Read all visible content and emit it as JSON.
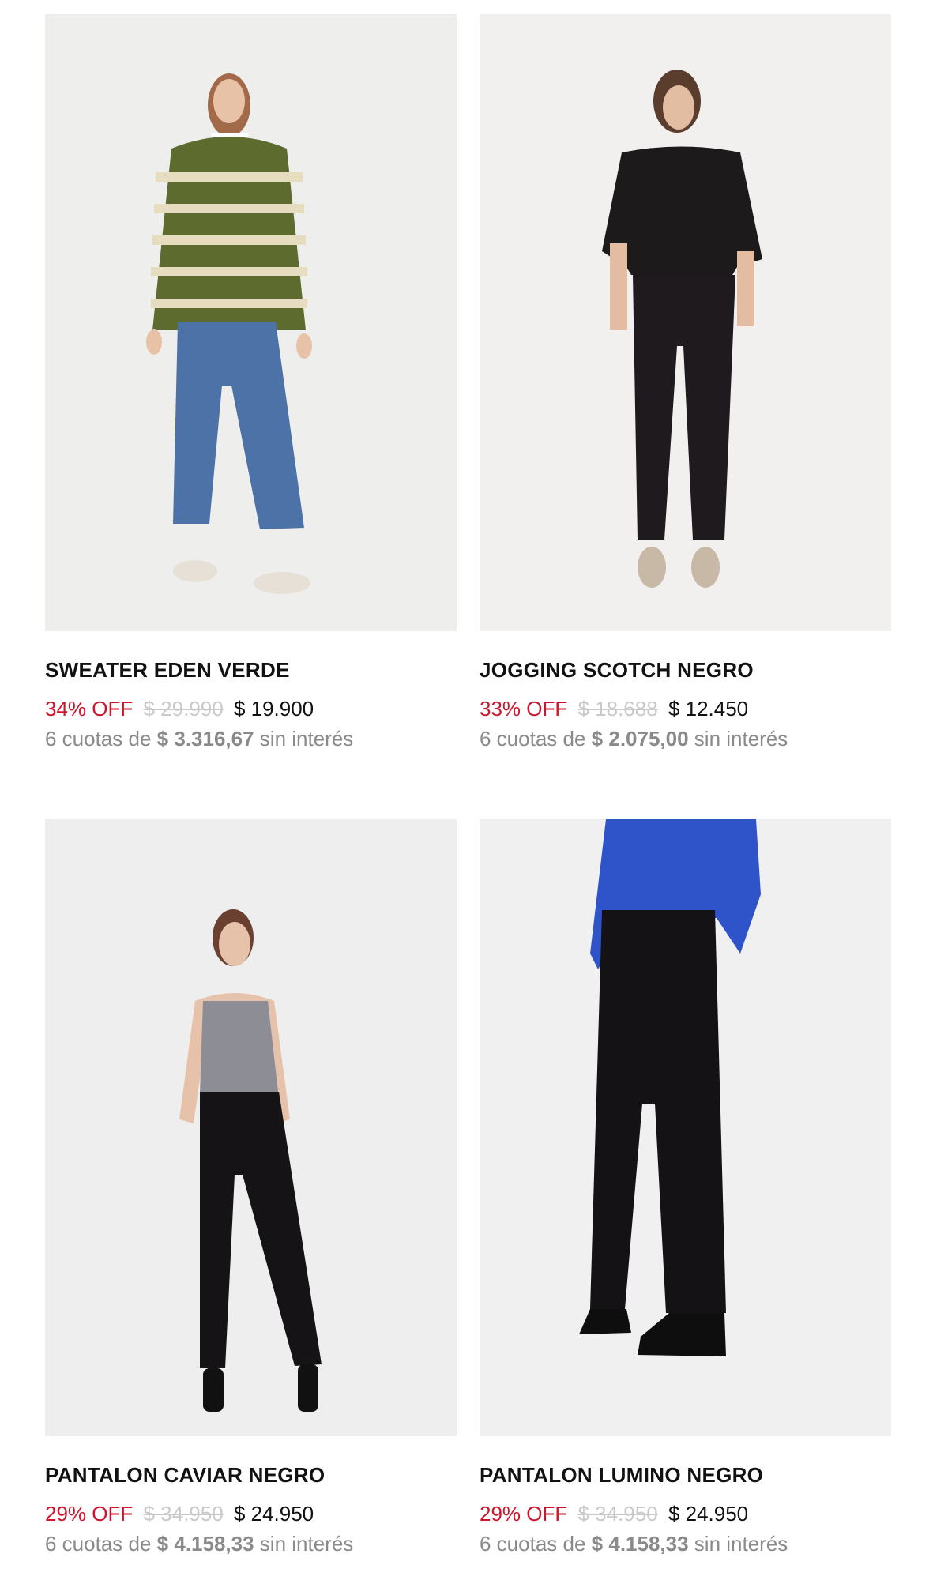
{
  "products": [
    {
      "name": "SWEATER EDEN VERDE",
      "discount": "34% OFF",
      "old_price": "$ 29.990",
      "price": "$ 19.900",
      "installments_prefix": "6 cuotas de",
      "installment_amount": "$ 3.316,67",
      "installments_suffix": "sin interés"
    },
    {
      "name": "JOGGING SCOTCH NEGRO",
      "discount": "33% OFF",
      "old_price": "$ 18.688",
      "price": "$ 12.450",
      "installments_prefix": "6 cuotas de",
      "installment_amount": "$ 2.075,00",
      "installments_suffix": "sin interés"
    },
    {
      "name": "PANTALON CAVIAR NEGRO",
      "discount": "29% OFF",
      "old_price": "$ 34.950",
      "price": "$ 24.950",
      "installments_prefix": "6 cuotas de",
      "installment_amount": "$ 4.158,33",
      "installments_suffix": "sin interés"
    },
    {
      "name": "PANTALON LUMINO NEGRO",
      "discount": "29% OFF",
      "old_price": "$ 34.950",
      "price": "$ 24.950",
      "installments_prefix": "6 cuotas de",
      "installment_amount": "$ 4.158,33",
      "installments_suffix": "sin interés"
    }
  ],
  "colors": {
    "discount": "#d0142c",
    "old_price": "#c9c9c9",
    "muted": "#8a8a8a",
    "photo_bg": "#eeeeec"
  }
}
